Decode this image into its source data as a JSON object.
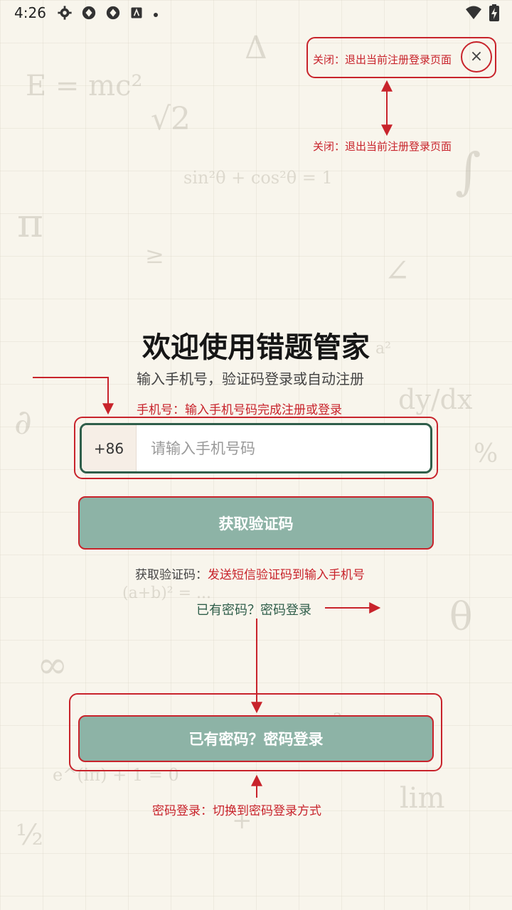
{
  "status_bar": {
    "time": "4:26",
    "icons_left": [
      "gear-icon",
      "vpn-icon",
      "vpn-icon",
      "accessibility-icon",
      "dot-icon"
    ],
    "icons_right": [
      "wifi-icon",
      "battery-charging-icon"
    ]
  },
  "header": {
    "close_symbol": "×"
  },
  "main": {
    "title": "欢迎使用错题管家",
    "subtitle": "输入手机号，验证码登录或自动注册",
    "phone": {
      "country_code": "+86",
      "placeholder": "请输入手机号码",
      "value": ""
    },
    "get_code_button": "获取验证码",
    "password_link": "已有密码？密码登录",
    "password_login_button": "已有密码？密码登录"
  },
  "annotations": {
    "close_top": "关闭：退出当前注册登录页面",
    "close_bottom": "关闭：退出当前注册登录页面",
    "phone": "手机号：输入手机号码完成注册或登录",
    "get_code_prefix": "获取验证码：",
    "get_code_desc": "发送短信验证码到输入手机号",
    "password_login": "密码登录：切换到密码登录方式"
  },
  "background_formulas": [
    "E = mc²",
    "Δ",
    "√2",
    "sin²θ + cos²θ = 1",
    "π",
    "∫",
    "≥",
    "∠",
    "a²",
    "∂",
    "dy/dx",
    "%",
    "≈",
    "(a+b)² = ...",
    "θ",
    "∞",
    "πr²",
    "e^(iπ) + 1 = 0",
    "lim",
    "½",
    "+"
  ],
  "colors": {
    "accent_red": "#c8232b",
    "teal_button": "#8db3a6",
    "dark_green": "#2f5e4a",
    "background": "#f8f5ec"
  }
}
